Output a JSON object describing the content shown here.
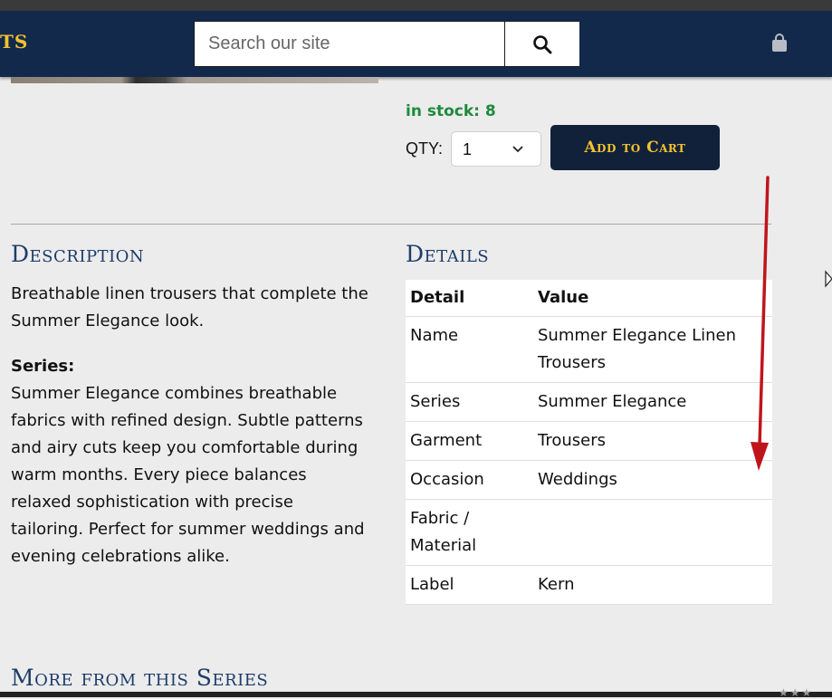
{
  "header": {
    "brand_fragment": "TS",
    "search": {
      "placeholder": "Search our site",
      "value": ""
    },
    "search_icon": "search-icon",
    "cart_icon": "shopping-bag-icon",
    "colors": {
      "header_bg": "#13294b",
      "accent": "#f2c230"
    }
  },
  "product": {
    "stock_text": "in stock: 8",
    "qty_label": "QTY:",
    "qty_value": "1",
    "add_to_cart_label": "Add to Cart"
  },
  "description": {
    "heading": "Description",
    "text": "Breathable linen trousers that complete the Summer Elegance look.",
    "series_label": "Series:",
    "series_text": "Summer Elegance combines breathable fabrics with refined design. Subtle patterns and airy cuts keep you comfortable during warm months. Every piece balances relaxed sophistication with precise tailoring. Perfect for summer weddings and evening celebrations alike."
  },
  "details": {
    "heading": "Details",
    "columns": [
      "Detail",
      "Value"
    ],
    "rows": [
      [
        "Name",
        "Summer Elegance Linen Trousers"
      ],
      [
        "Series",
        "Summer Elegance"
      ],
      [
        "Garment",
        "Trousers"
      ],
      [
        "Occasion",
        "Weddings"
      ],
      [
        "Fabric / Material",
        ""
      ],
      [
        "Label",
        "Kern"
      ]
    ]
  },
  "more_section": {
    "heading": "More from this Series"
  },
  "annotation": {
    "arrow_color": "#c0141c"
  }
}
